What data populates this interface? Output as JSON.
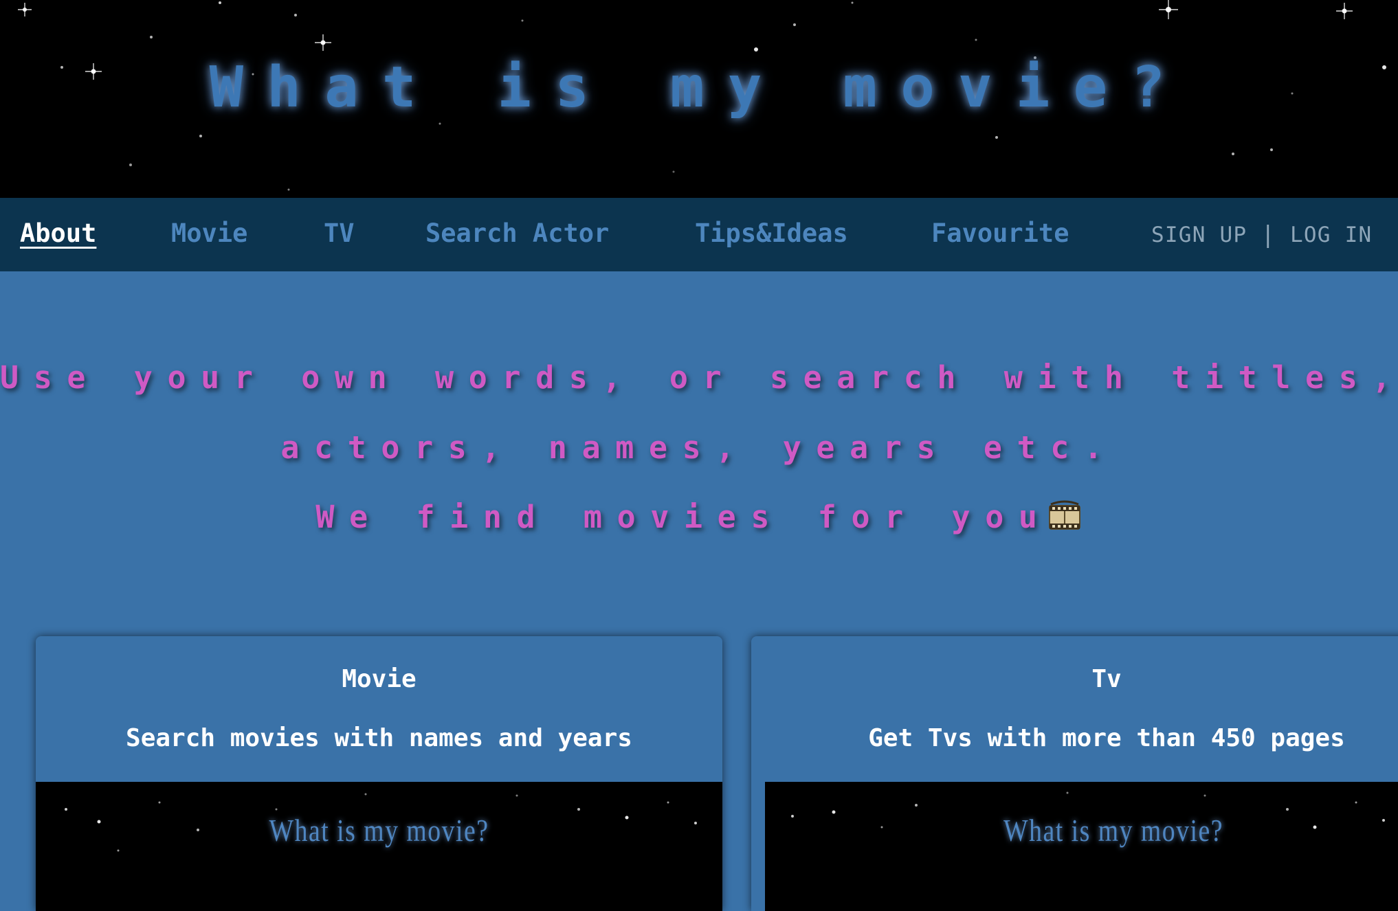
{
  "header": {
    "title": "What is my movie?"
  },
  "nav": {
    "items": [
      {
        "label": "About",
        "active": true
      },
      {
        "label": "Movie"
      },
      {
        "label": "TV"
      },
      {
        "label": "Search Actor"
      },
      {
        "label": "Tips&Ideas"
      },
      {
        "label": "Favourite"
      }
    ],
    "sign_up": "SIGN UP",
    "separator": "|",
    "log_in": "LOG IN"
  },
  "hero": {
    "line1": "Use your own words, or search with titles,",
    "line2": "actors, names, years etc.",
    "line3": "We find movies for you",
    "line3_icon": "film-frames-icon"
  },
  "cards": [
    {
      "title": "Movie",
      "description": "Search movies with names and years",
      "image_text": "What is my movie?"
    },
    {
      "title": "Tv",
      "description": "Get Tvs with more than 450 pages",
      "image_text": "What is my movie?"
    }
  ],
  "colors": {
    "page_background": "#3a72a8",
    "navbar": "#0c344f",
    "tagline": "#cf5ac4",
    "title_glow": "#3d78b5"
  }
}
